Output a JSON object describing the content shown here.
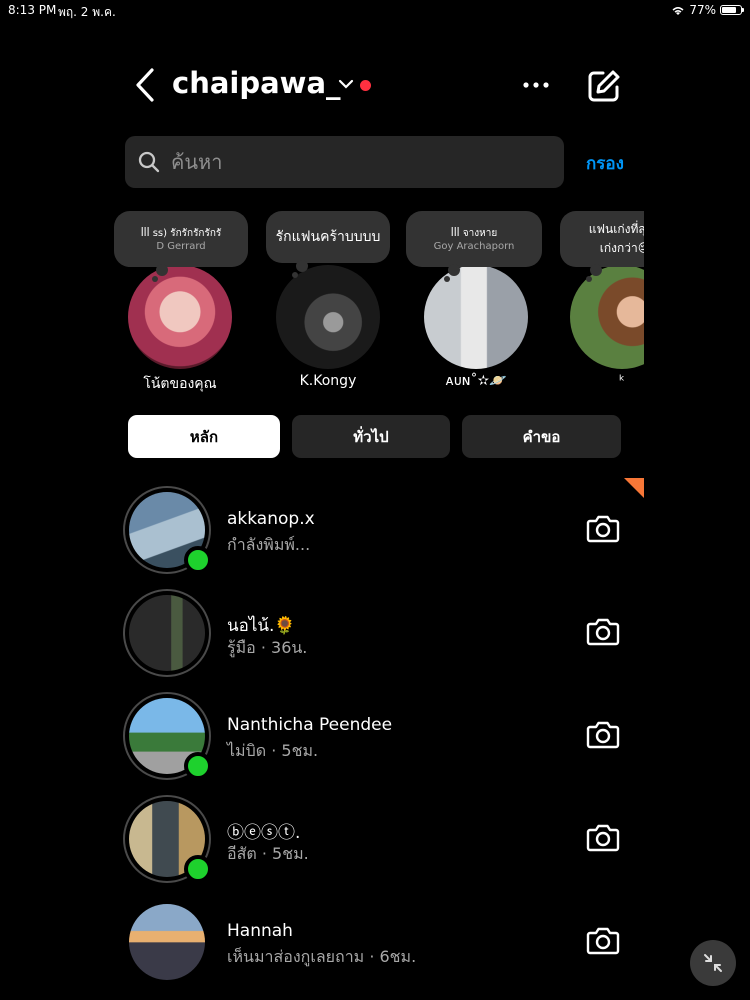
{
  "status_bar": {
    "time": "8:13 PM",
    "date": "พฤ. 2 พ.ค.",
    "battery": "77%",
    "battery_level": 0.77
  },
  "header": {
    "username": "chaipawa_"
  },
  "search": {
    "placeholder": "ค้นหา",
    "filter_label": "กรอง"
  },
  "stories": [
    {
      "name": "โน้ตของคุณ",
      "note_line1": "ꟾꟾꟾ ss)   รักรักรักรักรั",
      "note_line2": "D Gerrard"
    },
    {
      "name": "K.Kongy",
      "note_text": "รักแฟนคร้าบบบบ"
    },
    {
      "name": "ᴀᴜɴ˚✫🪐",
      "note_line1": "ꟾꟾꟾ  จางหาย",
      "note_line2": "Goy Arachaporn"
    },
    {
      "name": "ᵏ",
      "note_line1": "แฟนเก่งที่สุดแ",
      "note_line2": "เก่งกว่า😔"
    }
  ],
  "tabs": [
    "หลัก",
    "ทั่วไป",
    "คำขอ"
  ],
  "messages": [
    {
      "name": "akkanop.x",
      "subtitle": "กำลังพิมพ์...",
      "online": true
    },
    {
      "name": "นอไน้.🌻",
      "subtitle": "รู้มือ · 36น.",
      "online": false
    },
    {
      "name": "Nanthicha Peendee",
      "subtitle": "ไม่บิด · 5ชม.",
      "online": true
    },
    {
      "name": "ⓑⓔⓢⓣ.",
      "subtitle": "อีสัต · 5ชม.",
      "online": true
    },
    {
      "name": "Hannah",
      "subtitle": "เห็นมาส่องกูเลยถาม · 6ชม.",
      "online": false
    }
  ],
  "colors": {
    "accent": "#0095f6",
    "online": "#1ed12d",
    "notification": "#ff3040",
    "surface": "#262626"
  }
}
